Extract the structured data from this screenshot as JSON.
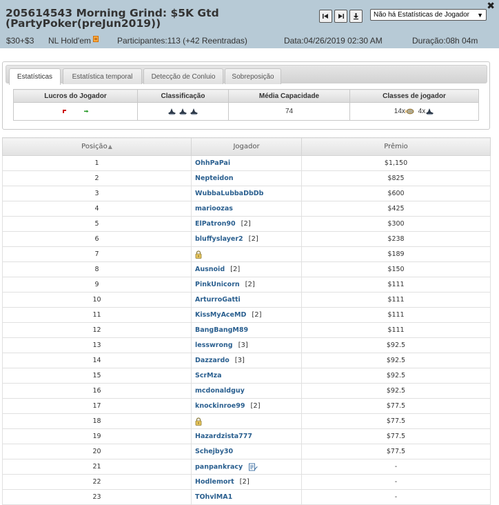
{
  "window": {
    "title": "205614543 Morning Grind: $5K Gtd (PartyPoker(preJun2019))",
    "close_label": "✖"
  },
  "header": {
    "buyin": "$30+$3",
    "game": "NL Hold'em",
    "participants": "Participantes:113 (+42 Reentradas)",
    "date": "Data:04/26/2019 02:30 AM",
    "duration": "Duração:08h 04m",
    "player_select_value": "Não há Estatísticas de Jogador"
  },
  "tabs": [
    {
      "label": "Estatísticas",
      "active": true
    },
    {
      "label": "Estatística temporal",
      "active": false
    },
    {
      "label": "Detecção de Conluio",
      "active": false
    },
    {
      "label": "Sobreposição",
      "active": false
    }
  ],
  "stats": {
    "headers": [
      "Lucros do Jogador",
      "Classificação",
      "Média Capacidade",
      "Classes de jogador"
    ],
    "avg_capacity": "74",
    "classes": {
      "fish_count": "14x",
      "shark_count": "4x"
    }
  },
  "results": {
    "headers": {
      "position": "Posição",
      "player": "Jogador",
      "prize": "Prêmio"
    },
    "rows": [
      {
        "pos": "1",
        "player": "OhhPaPai",
        "reentries": "",
        "prize": "$1,150",
        "locked": false,
        "note": false
      },
      {
        "pos": "2",
        "player": "Nepteidon",
        "reentries": "",
        "prize": "$825",
        "locked": false,
        "note": false
      },
      {
        "pos": "3",
        "player": "WubbaLubbaDbDb",
        "reentries": "",
        "prize": "$600",
        "locked": false,
        "note": false
      },
      {
        "pos": "4",
        "player": "marioozas",
        "reentries": "",
        "prize": "$425",
        "locked": false,
        "note": false
      },
      {
        "pos": "5",
        "player": "ElPatron90",
        "reentries": "[2]",
        "prize": "$300",
        "locked": false,
        "note": false
      },
      {
        "pos": "6",
        "player": "bluffyslayer2",
        "reentries": "[2]",
        "prize": "$238",
        "locked": false,
        "note": false
      },
      {
        "pos": "7",
        "player": "",
        "reentries": "",
        "prize": "$189",
        "locked": true,
        "note": false
      },
      {
        "pos": "8",
        "player": "Ausnoid",
        "reentries": "[2]",
        "prize": "$150",
        "locked": false,
        "note": false
      },
      {
        "pos": "9",
        "player": "PinkUnicorn",
        "reentries": "[2]",
        "prize": "$111",
        "locked": false,
        "note": false
      },
      {
        "pos": "10",
        "player": "ArturroGatti",
        "reentries": "",
        "prize": "$111",
        "locked": false,
        "note": false
      },
      {
        "pos": "11",
        "player": "KissMyAceMD",
        "reentries": "[2]",
        "prize": "$111",
        "locked": false,
        "note": false
      },
      {
        "pos": "12",
        "player": "BangBangM89",
        "reentries": "",
        "prize": "$111",
        "locked": false,
        "note": false
      },
      {
        "pos": "13",
        "player": "lesswrong",
        "reentries": "[3]",
        "prize": "$92.5",
        "locked": false,
        "note": false
      },
      {
        "pos": "14",
        "player": "Dazzardo",
        "reentries": "[3]",
        "prize": "$92.5",
        "locked": false,
        "note": false
      },
      {
        "pos": "15",
        "player": "ScrMza",
        "reentries": "",
        "prize": "$92.5",
        "locked": false,
        "note": false
      },
      {
        "pos": "16",
        "player": "mcdonaldguy",
        "reentries": "",
        "prize": "$92.5",
        "locked": false,
        "note": false
      },
      {
        "pos": "17",
        "player": "knockinroe99",
        "reentries": "[2]",
        "prize": "$77.5",
        "locked": false,
        "note": false
      },
      {
        "pos": "18",
        "player": "",
        "reentries": "",
        "prize": "$77.5",
        "locked": true,
        "note": false
      },
      {
        "pos": "19",
        "player": "Hazardzista777",
        "reentries": "",
        "prize": "$77.5",
        "locked": false,
        "note": false
      },
      {
        "pos": "20",
        "player": "Schejby30",
        "reentries": "",
        "prize": "$77.5",
        "locked": false,
        "note": false
      },
      {
        "pos": "21",
        "player": "panpankracy",
        "reentries": "",
        "prize": "-",
        "locked": false,
        "note": true
      },
      {
        "pos": "22",
        "player": "Hodlemort",
        "reentries": "[2]",
        "prize": "-",
        "locked": false,
        "note": false
      },
      {
        "pos": "23",
        "player": "TOhvlMA1",
        "reentries": "",
        "prize": "-",
        "locked": false,
        "note": false
      }
    ]
  },
  "colors": {
    "header_bg": "#b7cad6",
    "link": "#2a5f8f",
    "profit_down": "#cc0000",
    "profit_up": "#2a9a2a"
  }
}
